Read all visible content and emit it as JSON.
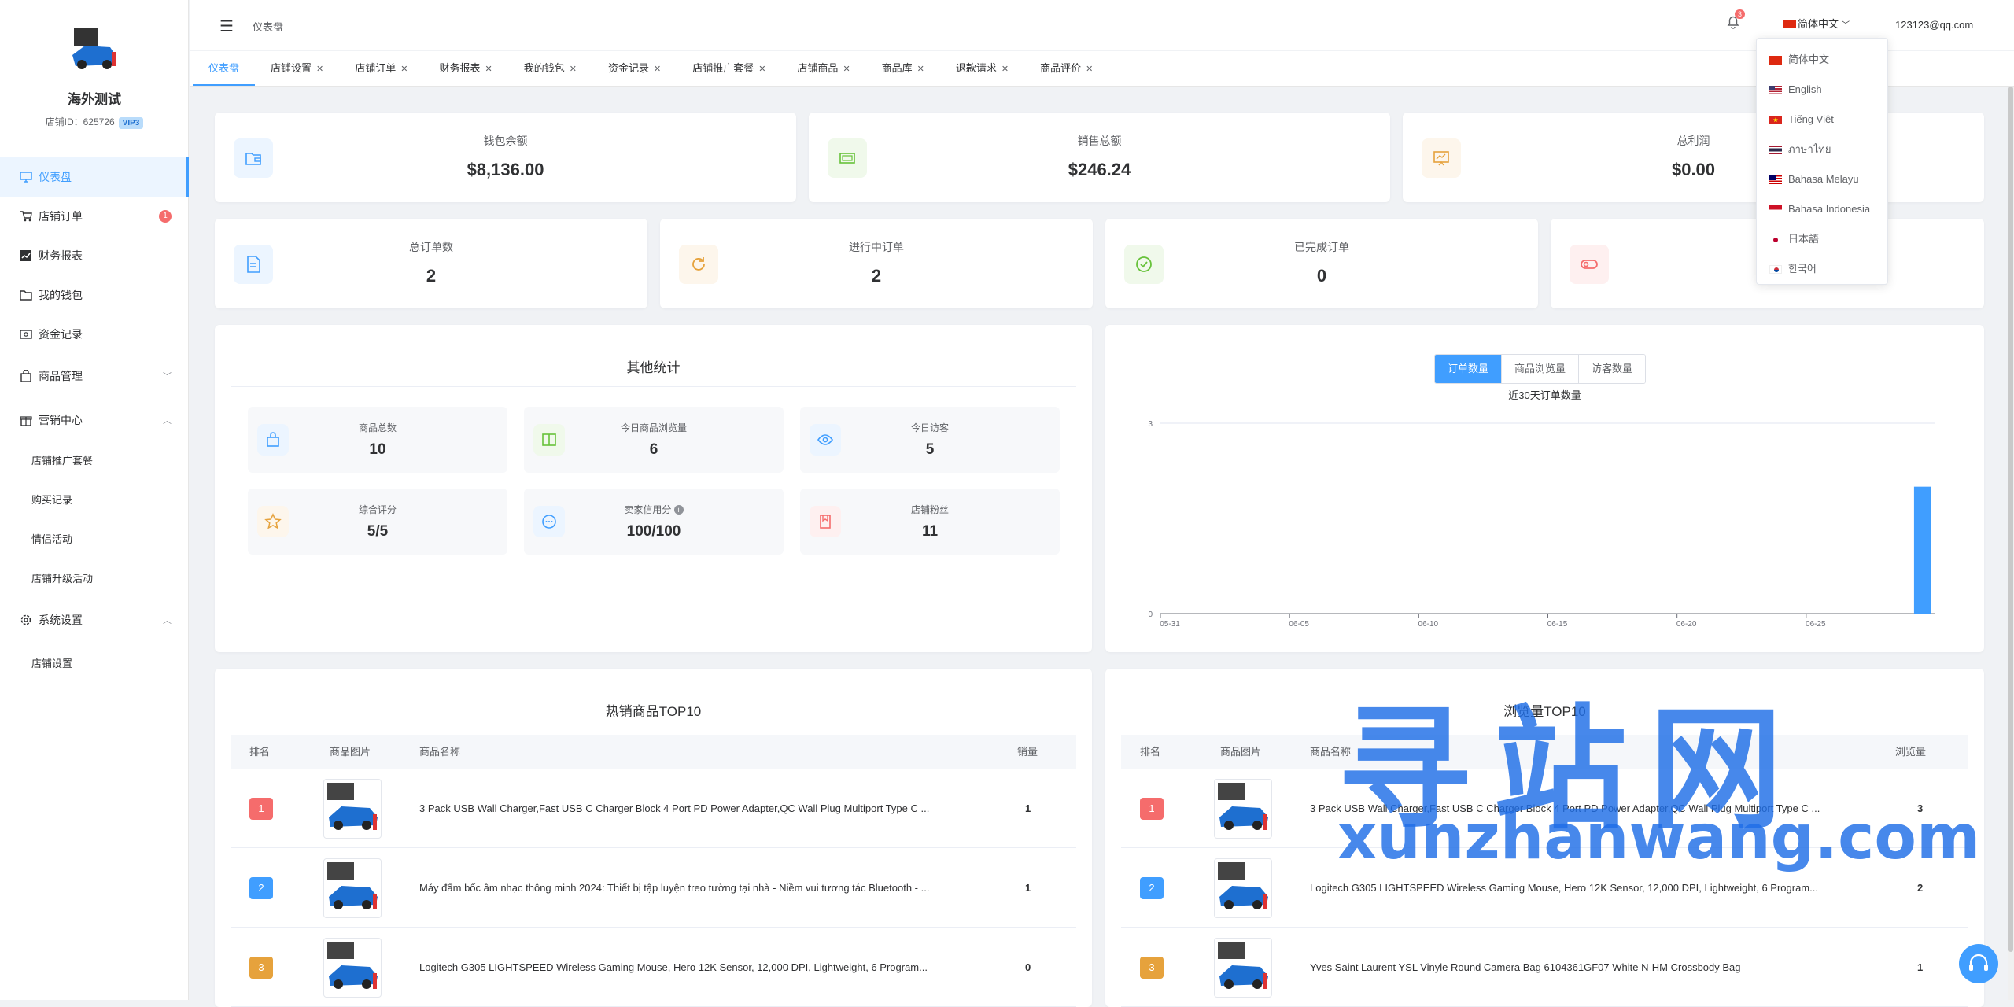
{
  "sidebar": {
    "shop_name": "海外测试",
    "shop_id": "店铺ID：625726",
    "vip": "VIP3",
    "items": [
      {
        "label": "仪表盘"
      },
      {
        "label": "店铺订单",
        "badge": "1"
      },
      {
        "label": "财务报表"
      },
      {
        "label": "我的钱包"
      },
      {
        "label": "资金记录"
      },
      {
        "label": "商品管理"
      },
      {
        "label": "营销中心"
      },
      {
        "label": "店铺推广套餐"
      },
      {
        "label": "购买记录"
      },
      {
        "label": "情侣活动"
      },
      {
        "label": "店铺升级活动"
      },
      {
        "label": "系统设置"
      },
      {
        "label": "店铺设置"
      }
    ]
  },
  "header": {
    "breadcrumb": "仪表盘",
    "bell_count": "3",
    "language": "简体中文",
    "user": "123123@qq.com"
  },
  "tabs": [
    "仪表盘",
    "店铺设置",
    "店铺订单",
    "财务报表",
    "我的钱包",
    "资金记录",
    "店铺推广套餐",
    "店铺商品",
    "商品库",
    "退款请求",
    "商品评价"
  ],
  "stats_top": [
    {
      "label": "钱包余额",
      "value": "$8,136.00"
    },
    {
      "label": "销售总额",
      "value": "$246.24"
    },
    {
      "label": "总利润",
      "value": "$0.00"
    }
  ],
  "stats_mid": [
    {
      "label": "总订单数",
      "value": "2"
    },
    {
      "label": "进行中订单",
      "value": "2"
    },
    {
      "label": "已完成订单",
      "value": "0"
    }
  ],
  "other_stats": {
    "title": "其他统计",
    "items": [
      {
        "label": "商品总数",
        "value": "10"
      },
      {
        "label": "今日商品浏览量",
        "value": "6"
      },
      {
        "label": "今日访客",
        "value": "5"
      },
      {
        "label": "综合评分",
        "value": "5/5"
      },
      {
        "label": "卖家信用分",
        "value": "100/100"
      },
      {
        "label": "店铺粉丝",
        "value": "11"
      }
    ]
  },
  "chart_panel": {
    "tabs": [
      "订单数量",
      "商品浏览量",
      "访客数量"
    ]
  },
  "chart_data": {
    "type": "bar",
    "title": "近30天订单数量",
    "x_ticks": [
      "05-31",
      "06-05",
      "06-10",
      "06-15",
      "06-20",
      "06-25"
    ],
    "categories": [
      "05-31",
      "06-01",
      "06-02",
      "06-03",
      "06-04",
      "06-05",
      "06-06",
      "06-07",
      "06-08",
      "06-09",
      "06-10",
      "06-11",
      "06-12",
      "06-13",
      "06-14",
      "06-15",
      "06-16",
      "06-17",
      "06-18",
      "06-19",
      "06-20",
      "06-21",
      "06-22",
      "06-23",
      "06-24",
      "06-25",
      "06-26",
      "06-27",
      "06-28",
      "06-29"
    ],
    "values": [
      0,
      0,
      0,
      0,
      0,
      0,
      0,
      0,
      0,
      0,
      0,
      0,
      0,
      0,
      0,
      0,
      0,
      0,
      0,
      0,
      0,
      0,
      0,
      0,
      0,
      0,
      0,
      0,
      0,
      2
    ],
    "ylim": [
      0,
      3
    ],
    "y_ticks": [
      "0",
      "3"
    ],
    "color": "#409eff"
  },
  "top_sales": {
    "title": "热销商品TOP10",
    "headers": [
      "排名",
      "商品图片",
      "商品名称",
      "销量"
    ],
    "rows": [
      {
        "rank": "1",
        "name": "3 Pack USB Wall Charger,Fast USB C Charger Block 4 Port PD Power Adapter,QC Wall Plug Multiport Type C ...",
        "value": "1"
      },
      {
        "rank": "2",
        "name": "Máy đẩm bốc âm nhạc thông minh 2024: Thiết bị tập luyện treo tường tại nhà - Niềm vui tương tác Bluetooth - ...",
        "value": "1"
      },
      {
        "rank": "3",
        "name": "Logitech G305 LIGHTSPEED Wireless Gaming Mouse, Hero 12K Sensor, 12,000 DPI, Lightweight, 6 Program...",
        "value": "0"
      }
    ]
  },
  "top_views": {
    "title": "浏览量TOP10",
    "headers": [
      "排名",
      "商品图片",
      "商品名称",
      "浏览量"
    ],
    "rows": [
      {
        "rank": "1",
        "name": "3 Pack USB Wall Charger,Fast USB C Charger Block 4 Port PD Power Adapter,QC Wall Plug Multiport Type C ...",
        "value": "3"
      },
      {
        "rank": "2",
        "name": "Logitech G305 LIGHTSPEED Wireless Gaming Mouse, Hero 12K Sensor, 12,000 DPI, Lightweight, 6 Program...",
        "value": "2"
      },
      {
        "rank": "3",
        "name": "Yves Saint Laurent YSL Vinyle Round Camera Bag 6104361GF07 White N-HM Crossbody Bag",
        "value": "1"
      }
    ]
  },
  "languages": [
    "简体中文",
    "English",
    "Tiếng Việt",
    "ภาษาไทย",
    "Bahasa Melayu",
    "Bahasa Indonesia",
    "日本語",
    "한국어"
  ],
  "watermark": {
    "cn": "寻站网",
    "en": "xunzhanwang.com"
  },
  "colors": {
    "accent": "#409eff",
    "rank1": "#f56c6c",
    "rank2": "#409eff",
    "rank3": "#e6a23c"
  }
}
